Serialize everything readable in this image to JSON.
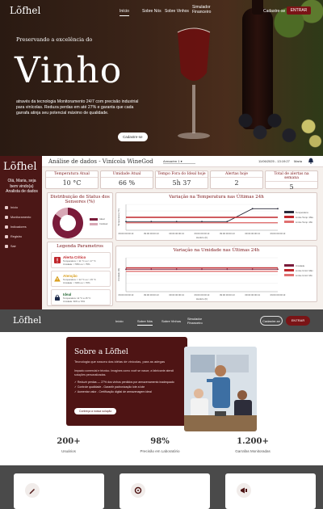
{
  "hero": {
    "logo": "Lõfhel",
    "nav": [
      "Início",
      "Sobre Nós",
      "Sobre Vinhos",
      "Simulador Financeiro"
    ],
    "login": "Cadastre-se",
    "enter": "ENTRAR",
    "eyebrow": "Preservando a excelência do",
    "title": "Vinho",
    "description": "através da tecnologia Monitoramento 24/7 com precisão industrial para vinícolas. Reduza perdas em até 27% e garanta que cada garrafa atinja seu potencial máximo de qualidade.",
    "cta": "Cadastre-se"
  },
  "dashboard": {
    "logo": "Lõfhel",
    "welcome": "Olá, Maria, seja bem vindo(a) Analista de dados",
    "sidebar": [
      "Início",
      "Monitoramento",
      "Indicadores",
      "Registro",
      "Sair"
    ],
    "title": "Análise de dados - Vinícola WineGod",
    "select": "Armazém 1",
    "date": "11/06/2025 - 13:19:27",
    "user": "Maria",
    "stats": [
      {
        "label": "Temperatura Atual",
        "value": "10 °C"
      },
      {
        "label": "Umidade Atual",
        "value": "66 %"
      },
      {
        "label": "Tempo Fora do Ideal hoje",
        "value": "5h 37"
      },
      {
        "label": "Alertas hoje",
        "value": "2"
      },
      {
        "label": "Total de alertas na semana",
        "value": "5"
      }
    ],
    "status_title": "Distribuição de Status dos Sensores (%)",
    "status_legend": [
      "Ideal",
      "Instável"
    ],
    "alerts_title": "Legenda Parametros",
    "alerts": [
      {
        "title": "Alerta Crítico",
        "line1": "Temperatura: < 11 °C ou > 17 °C",
        "line2": "Umidade: < 55% ou > 75%",
        "color": "#c0262b"
      },
      {
        "title": "Atenção",
        "line1": "Temperatura: < 12 °C ou > 15 °C",
        "line2": "Umidade: < 60% ou > 70%",
        "color": "#d99d1c"
      },
      {
        "title": "Ideal",
        "line1": "Temperatura: 12 °C a 15 °C",
        "line2": "Umidade: 60% a 70%",
        "color": "#2a6b3a"
      }
    ],
    "temp_title": "Variação na Temperatura nas Últimas 24h",
    "temp_legend": [
      "Temperatura",
      "Limite Temp. Máx",
      "Limite Temp. Mín"
    ],
    "hum_title": "Variação na Umidade nas Últimas 24h",
    "hum_legend": [
      "Umidade",
      "Limite Umid. Máx",
      "Limite Umid. Mín"
    ],
    "x_label": "Horário (h)",
    "time_ticks": [
      "09:00 00:00:13",
      "09:00 00:00:13",
      "09:00 00:00:13",
      "09:00 00:00:13",
      "09:00 00:00:13",
      "09:00 00:00:13",
      "09:00 00:00:13"
    ]
  },
  "chart_data": [
    {
      "type": "pie",
      "categories": [
        "Ideal",
        "Instável"
      ],
      "values": [
        85,
        15
      ],
      "title": "Distribuição de Status dos Sensores (%)"
    },
    {
      "type": "line",
      "title": "Variação na Temperatura nas Últimas 24h",
      "xlabel": "Horário (h)",
      "ylabel": "Temperatura (°C)",
      "series": [
        {
          "name": "Temperatura",
          "values": [
            4,
            4,
            4,
            4,
            4,
            10,
            10
          ]
        },
        {
          "name": "Limite Temp. Máx",
          "values": [
            6,
            6,
            6,
            6,
            6,
            6,
            6
          ]
        },
        {
          "name": "Limite Temp. Mín",
          "values": [
            3.5,
            3.5,
            3.5,
            3.5,
            3.5,
            3.5,
            3.5
          ]
        }
      ],
      "ylim": [
        0,
        12
      ]
    },
    {
      "type": "line",
      "title": "Variação na Umidade nas Últimas 24h",
      "xlabel": "Horário (h)",
      "ylabel": "Umidade (%)",
      "series": [
        {
          "name": "Umidade",
          "values": [
            66,
            66,
            66,
            66,
            66,
            66,
            66
          ]
        },
        {
          "name": "Limite Umid. Máx",
          "values": [
            70,
            70,
            70,
            70,
            70,
            70,
            70
          ]
        },
        {
          "name": "Limite Umid. Mín",
          "values": [
            60,
            60,
            60,
            60,
            60,
            60,
            60
          ]
        }
      ],
      "ylim": [
        0,
        100
      ]
    }
  ],
  "marketing": {
    "logo": "Lõfhel",
    "nav": [
      "Início",
      "Sobre Nós",
      "Sobre Vinhos",
      "Simulador Financeiro"
    ],
    "login": "Cadastre-se",
    "enter": "ENTRAR",
    "about_title": "Sobre a Lõfhel",
    "about_sub": "Tecnologia que nasceu das idéias de vinícolas, para as adegas",
    "about_body": "Impacto comercial e técnico. Imagines como você se nasce, a fabricante atendi soluções personalizadas.",
    "about_list": [
      "✓ Reduzir perdas — 27% dos vinhos perdidos por armazenamento inadequado",
      "✓ Controle qualidade - Garantir padronização lote a lote",
      "✓ Aumentar valor - Certificação digital de armazenagem ideal"
    ],
    "learn_more": "Conheça a nossa solução",
    "kpis": [
      {
        "value": "200+",
        "label": "Usuários"
      },
      {
        "value": "98%",
        "label": "Precisão em Laboratório"
      },
      {
        "value": "1.200+",
        "label": "Garrafas Monitoradas"
      }
    ]
  }
}
